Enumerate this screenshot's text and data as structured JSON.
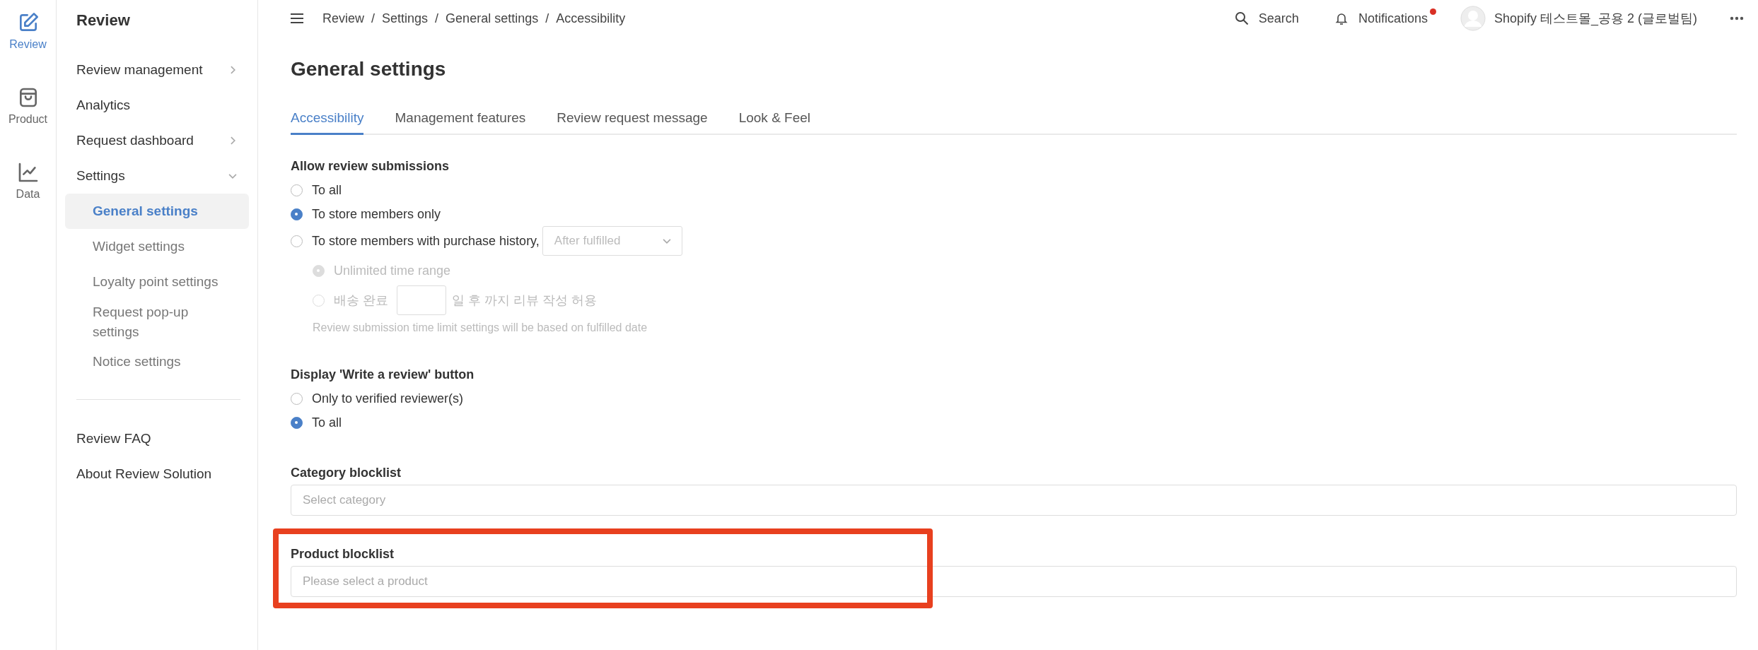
{
  "rail": [
    {
      "label": "Review",
      "kind": "edit",
      "selected": true
    },
    {
      "label": "Product",
      "kind": "bag",
      "selected": false
    },
    {
      "label": "Data",
      "kind": "chart",
      "selected": false
    }
  ],
  "sidebar": {
    "title": "Review",
    "items": [
      {
        "label": "Review management",
        "expanded": false
      },
      {
        "label": "Analytics"
      },
      {
        "label": "Request dashboard",
        "expanded": false
      },
      {
        "label": "Settings",
        "expanded": true,
        "children": [
          {
            "label": "General settings",
            "selected": true
          },
          {
            "label": "Widget settings",
            "selected": false
          },
          {
            "label": "Loyalty point settings",
            "selected": false
          },
          {
            "label": "Request pop-up settings",
            "selected": false
          },
          {
            "label": "Notice settings",
            "selected": false
          }
        ]
      }
    ],
    "footer_links": [
      "Review FAQ",
      "About Review Solution"
    ]
  },
  "topbar": {
    "separator": "/",
    "breadcrumb": [
      "Review",
      "Settings",
      "General settings",
      "Accessibility"
    ],
    "search": "Search",
    "notifications": "Notifications",
    "has_unread": true,
    "account": "Shopify 테스트몰_공용 2 (글로벌팀)"
  },
  "page_title": "General settings",
  "tabs": [
    {
      "label": "Accessibility",
      "selected": true
    },
    {
      "label": "Management features",
      "selected": false
    },
    {
      "label": "Review request message",
      "selected": false
    },
    {
      "label": "Look & Feel",
      "selected": false
    }
  ],
  "sections": [
    {
      "kind": "radio",
      "title": "Allow review submissions",
      "options": [
        {
          "label": "To all",
          "selected": false,
          "disabled": false
        },
        {
          "label": "To store members only",
          "selected": true,
          "disabled": false
        },
        {
          "label": "To store members with purchase history,",
          "selected": false,
          "disabled": false,
          "dropdown": {
            "value": "After fulfilled",
            "disabled": true
          },
          "sub_options": [
            {
              "label": "Unlimited time range",
              "selected": true,
              "disabled": true
            },
            {
              "label": "배송 완료",
              "label_after": "일 후 까지 리뷰 작성 허용",
              "has_input": true,
              "selected": false,
              "disabled": true
            }
          ],
          "note": "Review submission time limit settings will be based on fulfilled date"
        }
      ]
    },
    {
      "kind": "radio",
      "title": "Display 'Write a review' button",
      "options": [
        {
          "label": "Only to verified reviewer(s)",
          "selected": false,
          "disabled": false
        },
        {
          "label": "To all",
          "selected": true,
          "disabled": false
        }
      ]
    },
    {
      "kind": "select",
      "title": "Category blocklist",
      "placeholder": "Select category"
    },
    {
      "kind": "select",
      "title": "Product blocklist",
      "placeholder": "Please select a product",
      "highlighted": true
    }
  ]
}
